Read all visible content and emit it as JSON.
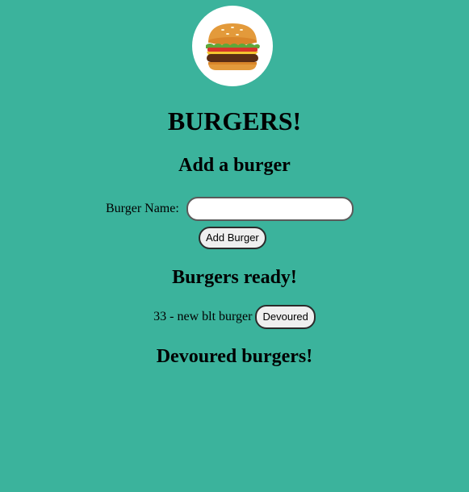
{
  "header": {
    "title": "BURGERS!"
  },
  "add_section": {
    "title": "Add a burger",
    "label": "Burger Name:",
    "input_value": "",
    "submit_label": "Add Burger"
  },
  "ready_section": {
    "title": "Burgers ready!",
    "items": [
      {
        "text": "33 - new blt burger",
        "button_label": "Devoured"
      }
    ]
  },
  "devoured_section": {
    "title": "Devoured burgers!"
  },
  "colors": {
    "background": "#3bb39c",
    "logo_background": "#ffffff"
  },
  "icons": {
    "logo": "burger-icon"
  }
}
